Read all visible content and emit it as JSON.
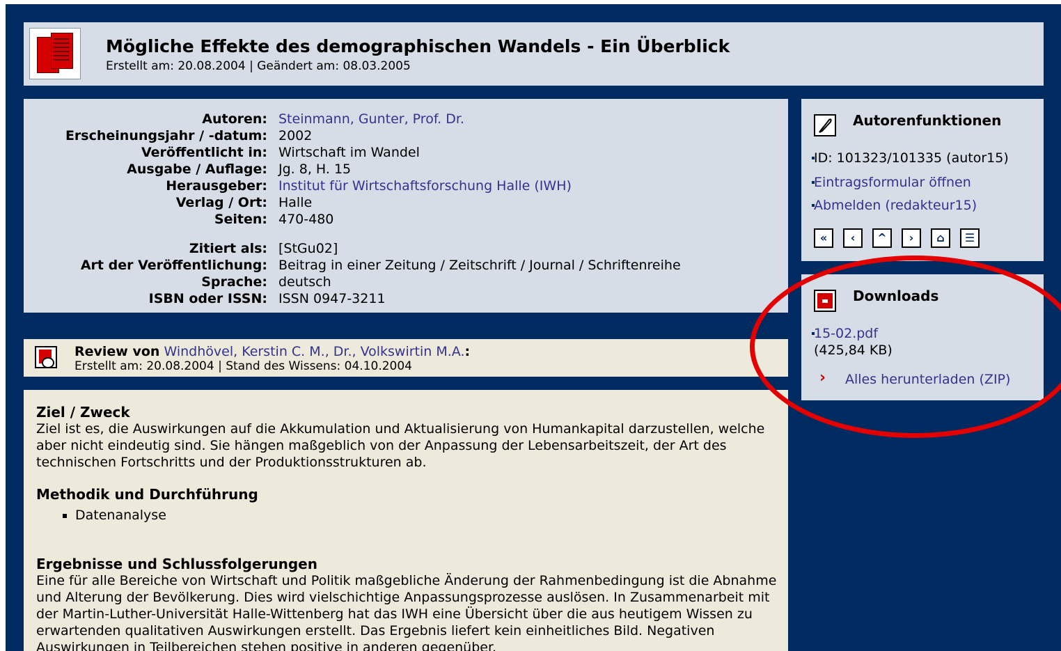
{
  "header": {
    "title": "Mögliche Effekte des demographischen Wandels - Ein Überblick",
    "subtitle": "Erstellt am: 20.08.2004 | Geändert am: 08.03.2005"
  },
  "meta": {
    "rows": [
      {
        "label": "Autoren:",
        "value": "Steinmann, Gunter, Prof. Dr.",
        "link": true
      },
      {
        "label": "Erscheinungsjahr / -datum:",
        "value": "2002"
      },
      {
        "label": "Veröffentlicht in:",
        "value": "Wirtschaft im Wandel"
      },
      {
        "label": "Ausgabe / Auflage:",
        "value": "Jg. 8, H. 15"
      },
      {
        "label": "Herausgeber:",
        "value": "Institut für Wirtschaftsforschung Halle (IWH)",
        "link": true
      },
      {
        "label": "Verlag / Ort:",
        "value": "Halle"
      },
      {
        "label": "Seiten:",
        "value": "470-480"
      },
      {
        "label": "Zitiert als:",
        "value": "[StGu02]"
      },
      {
        "label": "Art der Veröffentlichung:",
        "value": "Beitrag in einer Zeitung / Zeitschrift / Journal / Schriftenreihe"
      },
      {
        "label": "Sprache:",
        "value": "deutsch"
      },
      {
        "label": "ISBN oder ISSN:",
        "value": "ISSN 0947-3211"
      }
    ]
  },
  "autor": {
    "title": "Autorenfunktionen",
    "id_text": "ID: 101323/101335 (autor15)",
    "link1": "Eintragsformular öffnen",
    "link2": "Abmelden (redakteur15)",
    "nav": [
      "«",
      "‹",
      "^",
      "›",
      "⌂",
      "☰"
    ]
  },
  "downloads": {
    "title": "Downloads",
    "file": "15-02.pdf",
    "size": "(425,84 KB)",
    "all": "Alles herunterladen (ZIP)",
    "arrow": "›"
  },
  "review": {
    "prefix": "Review von",
    "author": "Windhövel, Kerstin C. M., Dr., Volkswirtin M.A.",
    "suffix": ":",
    "meta": "Erstellt am: 20.08.2004 | Stand des Wissens: 04.10.2004",
    "sections": {
      "s1_title": "Ziel / Zweck",
      "s1_text": "Ziel ist es, die Auswirkungen auf die Akkumulation und Aktualisierung von Humankapital darzustellen, welche aber nicht eindeutig sind. Sie hängen maßgeblich von der Anpassung der Lebensarbeitszeit, der Art des technischen Fortschritts und der Produktionsstrukturen ab.",
      "s2_title": "Methodik und Durchführung",
      "s2_item": "Datenanalyse",
      "s3_title": "Ergebnisse und Schlussfolgerungen",
      "s3_text": "Eine für alle Bereiche von Wirtschaft und Politik maßgebliche Änderung der Rahmenbedingung ist die Abnahme und Alterung der Bevölkerung. Dies wird vielschichtige Anpassungsprozesse auslösen. In Zusammenarbeit mit der Martin-Luther-Universität Halle-Wittenberg hat das IWH eine Übersicht über die aus heutigem Wissen zu erwartenden qualitativen Auswirkungen erstellt. Das Ergebnis liefert kein einheitliches Bild. Negativen Auswirkungen in Teilbereichen stehen positive in anderen gegenüber."
    }
  },
  "colors": {
    "frame": "#002b60",
    "panel": "#d6dde6",
    "cream": "#eeeadb",
    "link": "#33338f",
    "accent_red": "#d40000",
    "ellipse": "#e20000"
  }
}
